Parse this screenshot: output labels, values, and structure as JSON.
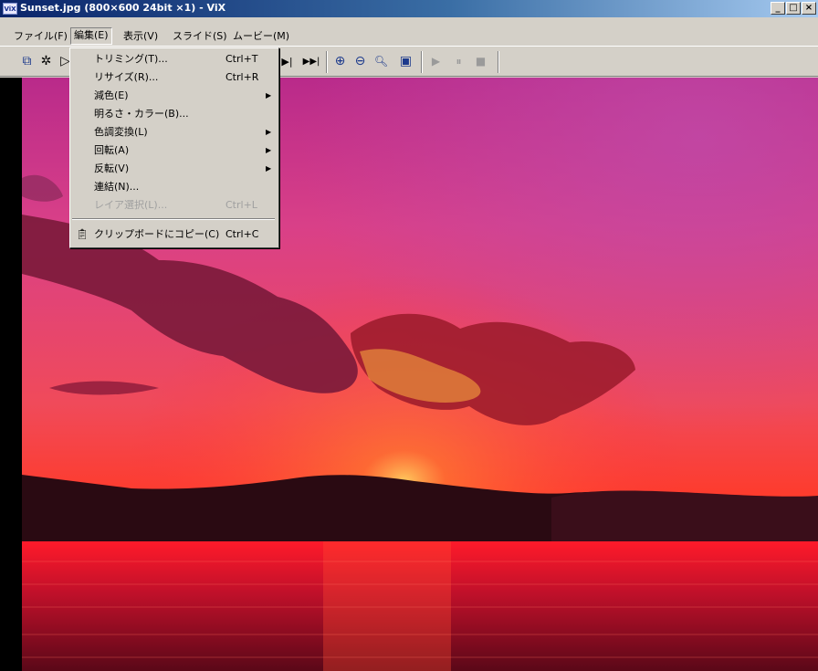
{
  "window": {
    "title": "Sunset.jpg (800×600 24bit ×1) - ViX",
    "icon_label": "ViX",
    "controls": {
      "minimize": "_",
      "maximize": "□",
      "close": "×"
    }
  },
  "menubar": {
    "items": [
      {
        "label": "ファイル(F)"
      },
      {
        "label": "編集(E)"
      },
      {
        "label": "表示(V)"
      },
      {
        "label": "スライド(S)"
      },
      {
        "label": "ムービー(M)"
      }
    ]
  },
  "toolbar": {
    "buttons": [
      {
        "icon": "window-icon",
        "glyph": "⧉"
      },
      {
        "icon": "sparkle-icon",
        "glyph": "✲"
      },
      {
        "icon": "cursor-icon",
        "glyph": "▷"
      },
      {
        "icon": "next-icon",
        "glyph": "▶|"
      },
      {
        "icon": "last-icon",
        "glyph": "▶▶|"
      },
      {
        "icon": "zoom-in-icon",
        "glyph": "⊕"
      },
      {
        "icon": "zoom-out-icon",
        "glyph": "⊖"
      },
      {
        "icon": "zoom-icon",
        "glyph": "🔍︎"
      },
      {
        "icon": "monitor-icon",
        "glyph": "▣"
      },
      {
        "icon": "play-icon",
        "glyph": "▶"
      },
      {
        "icon": "pause-icon",
        "glyph": "⏸"
      },
      {
        "icon": "stop-icon",
        "glyph": "■"
      }
    ]
  },
  "edit_menu": {
    "items": [
      {
        "label": "トリミング(T)...",
        "shortcut": "Ctrl+T"
      },
      {
        "label": "リサイズ(R)...",
        "shortcut": "Ctrl+R"
      },
      {
        "label": "減色(E)",
        "submenu": true
      },
      {
        "label": "明るさ・カラー(B)..."
      },
      {
        "label": "色調変換(L)",
        "submenu": true
      },
      {
        "label": "回転(A)",
        "submenu": true
      },
      {
        "label": "反転(V)",
        "submenu": true
      },
      {
        "label": "連結(N)..."
      },
      {
        "label": "レイア選択(L)...",
        "shortcut": "Ctrl+L",
        "disabled": true
      },
      {
        "label": "クリップボードにコピー(C)",
        "shortcut": "Ctrl+C"
      }
    ]
  },
  "colors": {
    "title_start": "#0a246a",
    "title_end": "#a6caf0",
    "face": "#d4d0c8"
  }
}
